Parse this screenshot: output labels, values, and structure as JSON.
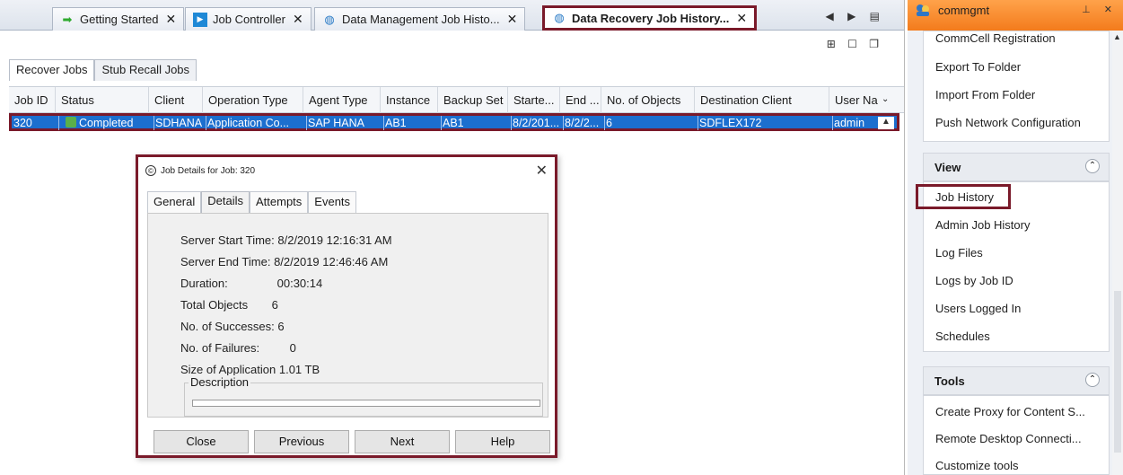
{
  "doc_tabs": [
    {
      "label": "Getting Started",
      "icon": "green-arrow-icon",
      "close": "✕"
    },
    {
      "label": "Job Controller",
      "icon": "play-icon",
      "close": "✕"
    },
    {
      "label": "Data Management Job Histo...",
      "icon": "globe-icon",
      "close": "✕"
    },
    {
      "label": "Data Recovery Job History...",
      "icon": "globe-icon",
      "close": "✕"
    }
  ],
  "tab_nav": "◀ ▶ ▤",
  "win_ctrls": "⊞ ☐ ❐",
  "inner_tabs": [
    "Recover Jobs",
    "Stub Recall Jobs"
  ],
  "columns": [
    "Job ID",
    "Status",
    "Client",
    "Operation Type",
    "Agent Type",
    "Instance",
    "Backup Set",
    "Starte...",
    "End ...",
    "No. of Objects",
    "Destination Client",
    "User Na"
  ],
  "row": {
    "job_id": "320",
    "status": "Completed",
    "client": "SDHANA",
    "operation_type": "Application Co...",
    "agent_type": "SAP HANA",
    "instance": "AB1",
    "backup_set": "AB1",
    "start": "8/2/201...",
    "end": "8/2/2...",
    "objects": "6",
    "destination": "SDFLEX172",
    "user": "admin"
  },
  "dialog": {
    "title": "Job Details for Job: 320",
    "tabs": [
      "General",
      "Details",
      "Attempts",
      "Events"
    ],
    "fields": [
      {
        "label": "Server Start Time:",
        "value": "8/2/2019 12:16:31 AM"
      },
      {
        "label": "Server End Time:",
        "value": "8/2/2019 12:46:46 AM"
      },
      {
        "label": "Duration:",
        "value": "00:30:14"
      },
      {
        "label": "Total Objects",
        "value": "6"
      },
      {
        "label": "No. of Successes:",
        "value": "6"
      },
      {
        "label": "No. of Failures:",
        "value": "0"
      },
      {
        "label": "Size of Application",
        "value": "1.01 TB"
      }
    ],
    "description_label": "Description",
    "buttons": [
      "Close",
      "Previous",
      "Next",
      "Help"
    ]
  },
  "right_pane": {
    "title": "commgmt",
    "ctrls": "⊥ ✕",
    "top_items": [
      "CommCell Registration",
      "Export To Folder",
      "Import From Folder",
      "Push Network Configuration"
    ],
    "view_title": "View",
    "view_items": [
      "Job History",
      "Admin Job History",
      "Log Files",
      "Logs by Job ID",
      "Users Logged In",
      "Schedules"
    ],
    "tools_title": "Tools",
    "tools_items": [
      "Create Proxy for Content S...",
      "Remote Desktop Connecti...",
      "Customize tools"
    ]
  },
  "colors": {
    "highlight_border": "#7a1a2a",
    "selection": "#1c6fcf",
    "pane_header": "#f37b1c"
  }
}
